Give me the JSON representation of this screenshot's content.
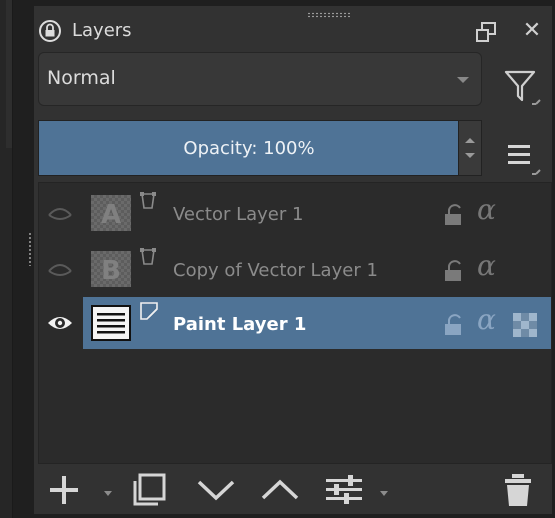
{
  "panel": {
    "title": "Layers"
  },
  "blending": {
    "mode": "Normal"
  },
  "opacity": {
    "label": "Opacity:  100%",
    "value_percent": 100
  },
  "layers": [
    {
      "name": "Vector Layer 1",
      "thumbnail_letter": "A",
      "visible": false,
      "selected": false
    },
    {
      "name": "Copy of Vector Layer 1",
      "thumbnail_letter": "B",
      "visible": false,
      "selected": false
    },
    {
      "name": "Paint Layer 1",
      "visible": true,
      "selected": true
    }
  ],
  "colors": {
    "accent": "#4f7396",
    "panel_bg": "#323232",
    "list_bg": "#2b2b2b",
    "text": "#d6d6d6",
    "dim_text": "#8b8b8b"
  },
  "icons": {
    "title": "lock-circle-icon",
    "float": "float-window-icon",
    "close": "close-icon",
    "filter": "filter-icon",
    "menu": "hamburger-menu-icon",
    "toolbar": [
      "add-layer-icon",
      "duplicate-layer-icon",
      "move-down-icon",
      "move-up-icon",
      "layer-properties-icon",
      "delete-layer-icon"
    ]
  }
}
